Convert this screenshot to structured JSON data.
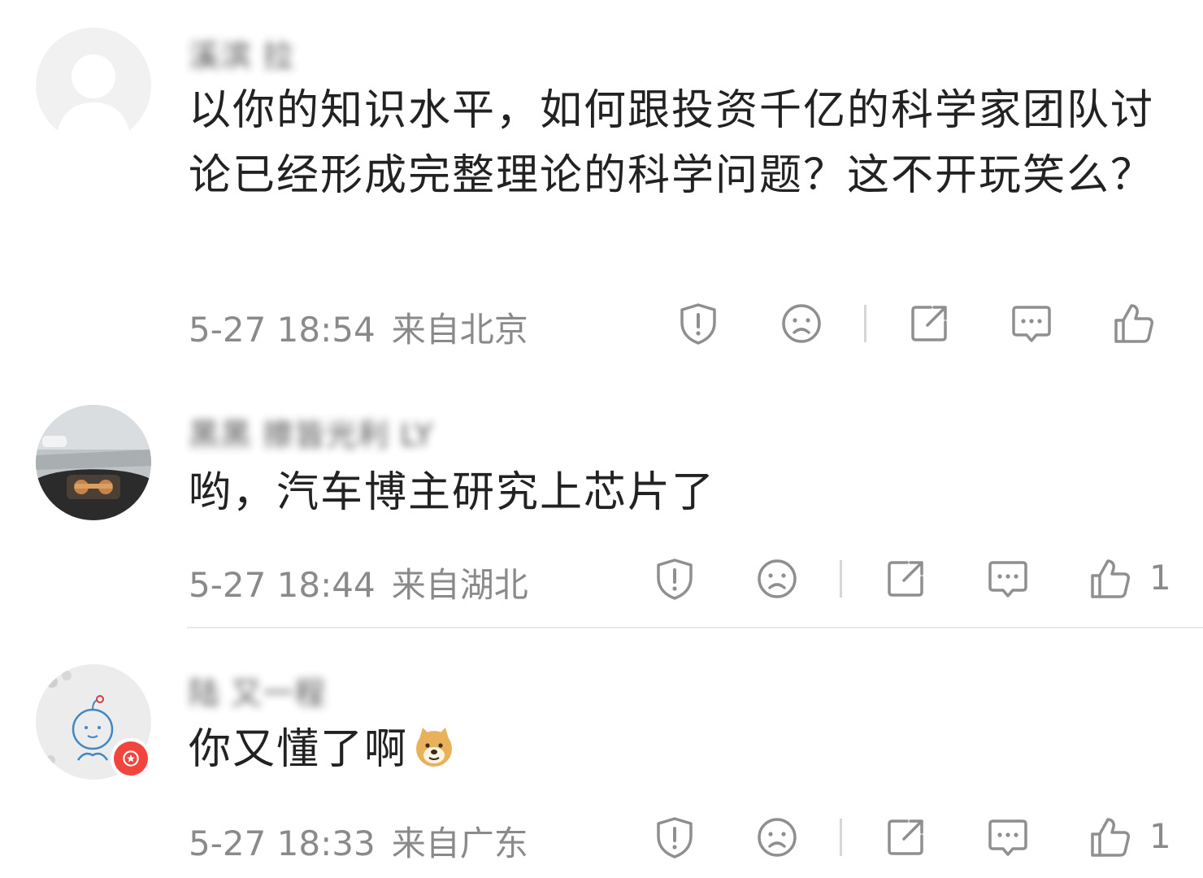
{
  "comments": [
    {
      "username": "溪滨 拉",
      "text": "以你的知识水平，如何跟投资千亿的科学家团队讨论已经形成完整理论的科学问题？这不开玩笑么？",
      "time": "5-27 18:54",
      "location": "来自北京",
      "likes": ""
    },
    {
      "username": "黑黑 擦皆光利 LY",
      "text": "哟，汽车博主研究上芯片了",
      "time": "5-27 18:44",
      "location": "来自湖北",
      "likes": "1"
    },
    {
      "username": "陆 又一程",
      "text": "你又懂了啊",
      "time": "5-27 18:33",
      "location": "来自广东",
      "likes": "1"
    }
  ],
  "icons": {
    "report": "shield-exclamation-icon",
    "dislike": "sad-face-icon",
    "share": "share-arrow-icon",
    "reply": "comment-bubble-icon",
    "like": "thumbs-up-icon",
    "emoji": "doge-emoji-icon",
    "badge": "star-badge-icon"
  },
  "colors": {
    "text": "#222222",
    "meta": "#8a8a8a",
    "icon": "#8f8f8f",
    "badge": "#f0443c"
  }
}
